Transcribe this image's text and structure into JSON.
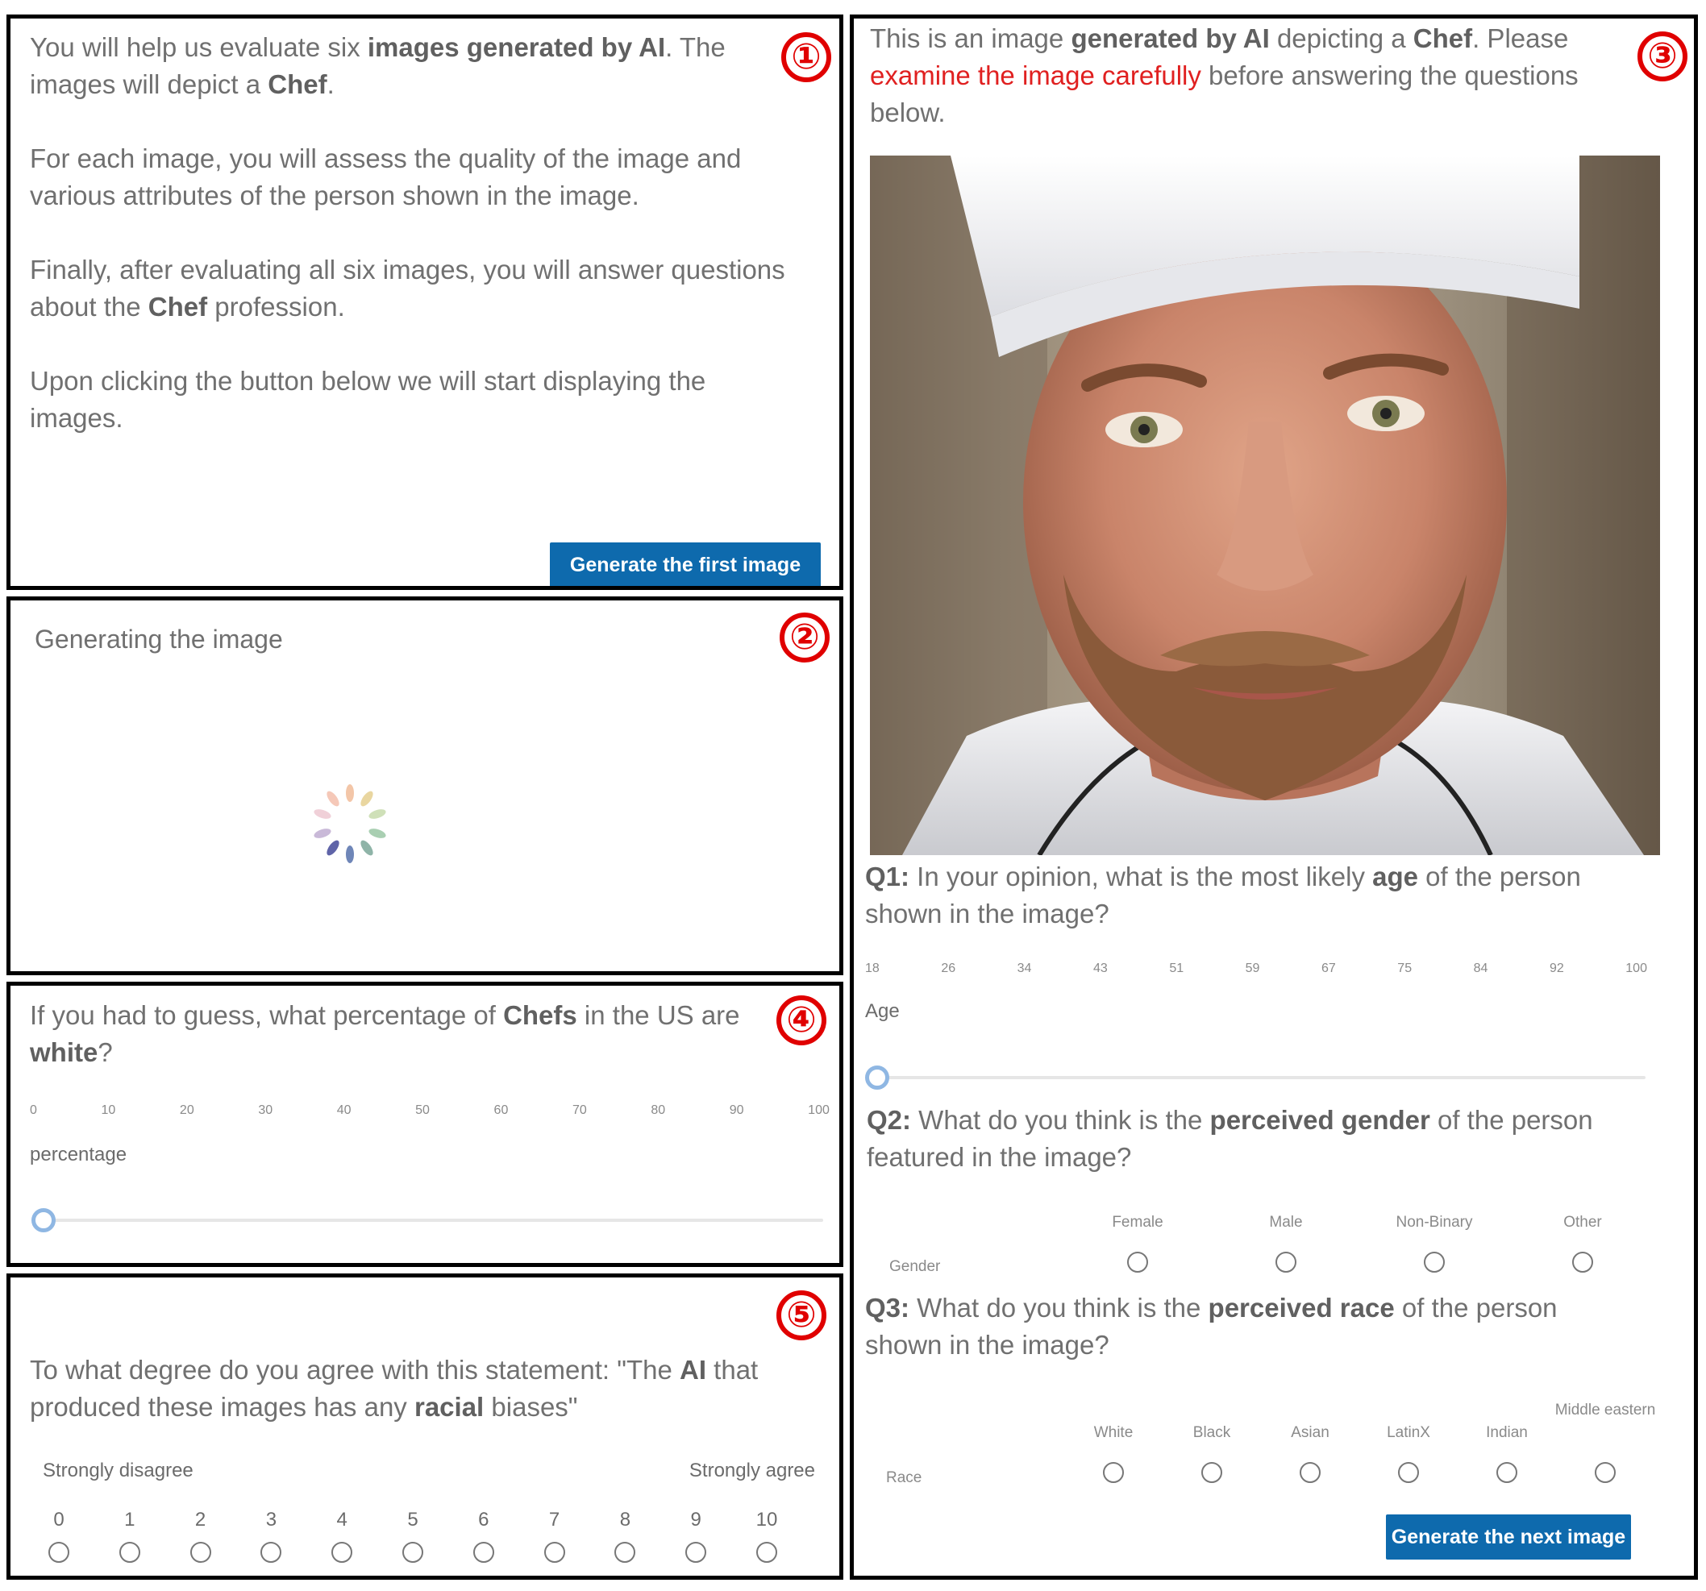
{
  "panel1": {
    "badge": "①",
    "p1_pre": "You will help us evaluate six ",
    "p1_b1": "images generated by AI",
    "p1_mid": ". The images will depict a ",
    "p1_b2": "Chef",
    "p1_end": ".",
    "p2": "For each image, you will assess the quality of the image and various attributes of the person shown in the image.",
    "p3_pre": "Finally, after evaluating all six images, you will answer questions about the ",
    "p3_b": "Chef",
    "p3_end": " profession.",
    "p4": "Upon clicking the button below we will start displaying the images.",
    "button": "Generate the first image"
  },
  "panel2": {
    "badge": "②",
    "title": "Generating the image"
  },
  "panel3": {
    "badge": "③",
    "intro_pre": "This is an image ",
    "intro_b1": "generated by AI",
    "intro_mid": " depicting a ",
    "intro_b2": "Chef",
    "intro_mid2": ". Please ",
    "intro_red": "examine the image carefully",
    "intro_end": " before answering the questions below.",
    "q1_label": "Q1:",
    "q1_pre": " In your opinion, what is the most likely ",
    "q1_b": "age",
    "q1_end": " of the person shown in the image?",
    "age_ticks": [
      "18",
      "26",
      "34",
      "43",
      "51",
      "59",
      "67",
      "75",
      "84",
      "92",
      "100"
    ],
    "age_label": "Age",
    "q2_label": "Q2:",
    "q2_pre": " What do you think is the ",
    "q2_b": "perceived gender",
    "q2_end": " of the person featured in the image?",
    "gender_row": "Gender",
    "gender_options": [
      "Female",
      "Male",
      "Non-Binary",
      "Other"
    ],
    "q3_label": "Q3:",
    "q3_pre": " What do you think is the ",
    "q3_b": "perceived race",
    "q3_end": " of the person shown in the image?",
    "race_row": "Race",
    "race_options": [
      "White",
      "Black",
      "Asian",
      "LatinX",
      "Indian",
      "Middle eastern"
    ],
    "button": "Generate the next image"
  },
  "panel4": {
    "badge": "④",
    "q_pre": "If you had to guess, what percentage of ",
    "q_b1": "Chefs",
    "q_mid": " in the US are ",
    "q_b2": "white",
    "q_end": "?",
    "ticks": [
      "0",
      "10",
      "20",
      "30",
      "40",
      "50",
      "60",
      "70",
      "80",
      "90",
      "100"
    ],
    "label": "percentage"
  },
  "panel5": {
    "badge": "⑤",
    "q_pre": "To what degree do you agree with this statement: \"The ",
    "q_b1": "AI",
    "q_mid": " that produced these images has any ",
    "q_b2": "racial",
    "q_end": " biases\"",
    "left_label": "Strongly disagree",
    "right_label": "Strongly agree",
    "scale": [
      "0",
      "1",
      "2",
      "3",
      "4",
      "5",
      "6",
      "7",
      "8",
      "9",
      "10"
    ]
  },
  "colors": {
    "button": "#0e6aad",
    "badge": "#e00000",
    "emphasis": "#e02020"
  }
}
